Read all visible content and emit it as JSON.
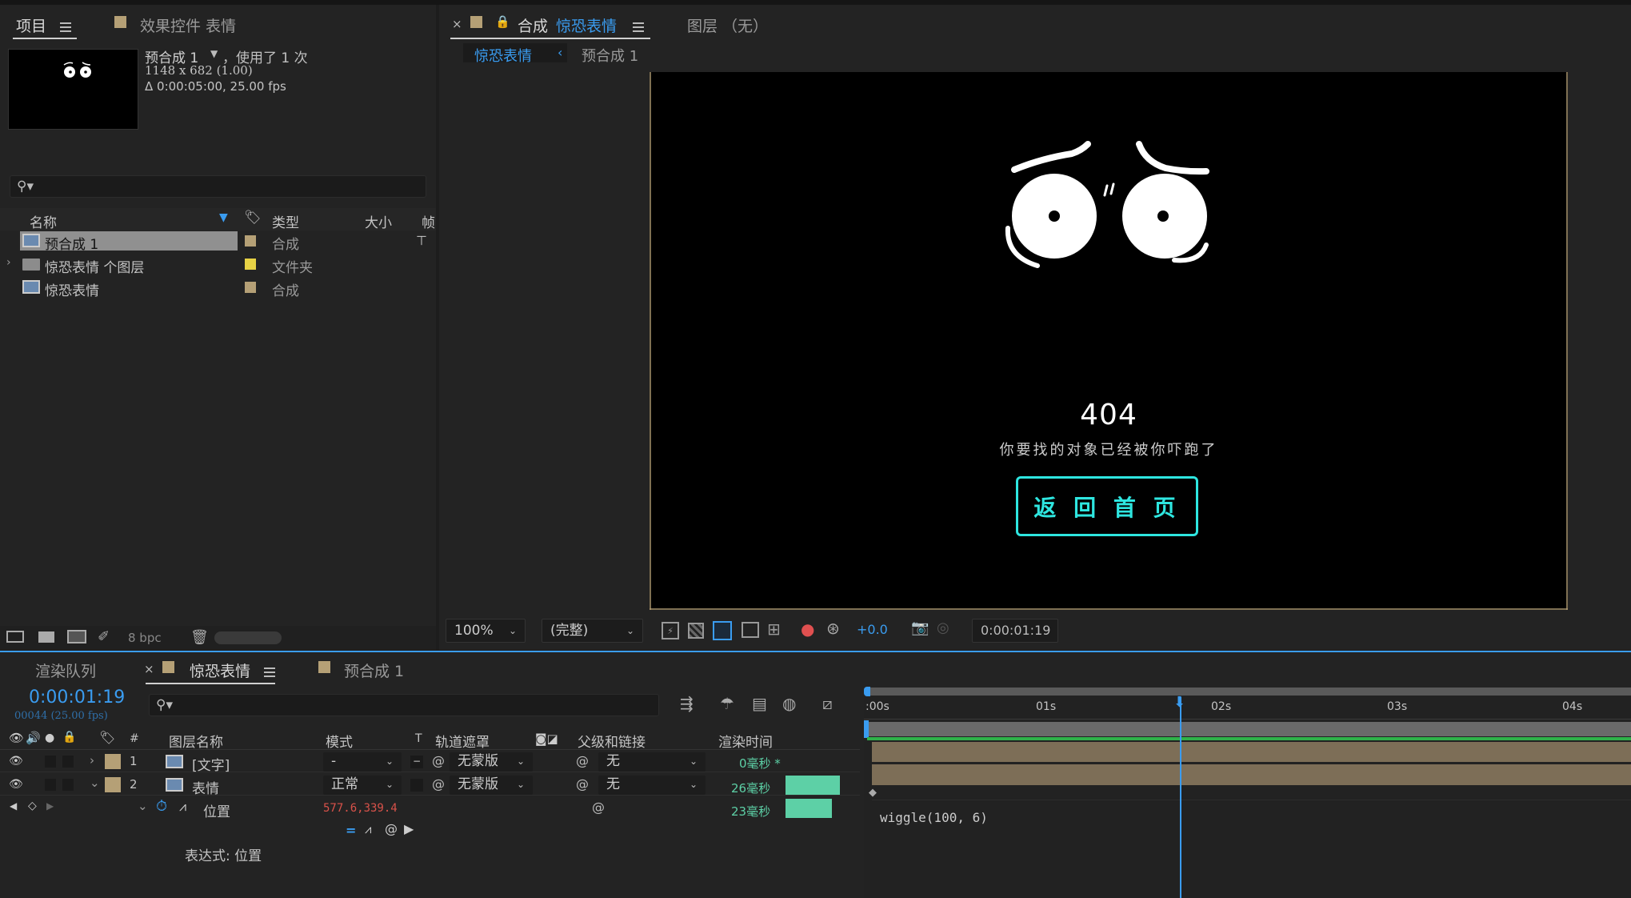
{
  "project_panel": {
    "tab_project": "项目",
    "tab_effects": "效果控件 表情",
    "selected_name": "预合成 1",
    "selected_usage": "，使用了 1 次",
    "selected_dims": "1148 x 682 (1.00)",
    "selected_duration": "Δ 0:00:05:00, 25.00 fps",
    "search_placeholder": "",
    "columns": {
      "name": "名称",
      "type": "类型",
      "size": "大小",
      "frame": "帧"
    },
    "items": [
      {
        "name": "预合成 1",
        "type": "合成",
        "label_color": "#b5a076",
        "selected": true
      },
      {
        "name": "惊恐表情 个图层",
        "type": "文件夹",
        "label_color": "#e7d245",
        "selected": false
      },
      {
        "name": "惊恐表情",
        "type": "合成",
        "label_color": "#b5a076",
        "selected": false
      }
    ],
    "bpc": "8 bpc"
  },
  "viewer": {
    "tab_comp_prefix": "合成",
    "tab_comp_name": "惊恐表情",
    "tab_layer": "图层 （无）",
    "breadcrumb_active": "惊恐表情",
    "breadcrumb_other": "预合成 1",
    "comp_404": "404",
    "comp_subtitle": "你要找的对象已经被你吓跑了",
    "comp_button": "返 回 首 页",
    "zoom": "100%",
    "resolution": "(完整)",
    "exposure": "+0.0",
    "timecode": "0:00:01:19"
  },
  "timeline": {
    "tab_render": "渲染队列",
    "tab_comp": "惊恐表情",
    "tab_precomp": "预合成 1",
    "current_time": "0:00:01:19",
    "frame_info": "00044 (25.00 fps)",
    "search_placeholder": "",
    "headers": {
      "hash": "#",
      "layer_name": "图层名称",
      "mode": "模式",
      "t": "T",
      "track_matte": "轨道遮罩",
      "parent": "父级和链接",
      "render_time": "渲染时间"
    },
    "layers": [
      {
        "num": "1",
        "name": "[文字]",
        "mode": "-",
        "matte": "无蒙版",
        "parent": "无",
        "render_time": "0毫秒 *"
      },
      {
        "num": "2",
        "name": "表情",
        "mode": "正常",
        "matte": "无蒙版",
        "parent": "无",
        "render_time": "26毫秒"
      }
    ],
    "property": {
      "name": "位置",
      "value": "577.6,339.4",
      "render_time": "23毫秒"
    },
    "expression_label": "表达式: 位置",
    "expression_code": "wiggle(100, 6)",
    "ruler": [
      "0s",
      "01s",
      "02s",
      "03s",
      "04s"
    ],
    "ruler_start": ":00s"
  },
  "colors": {
    "accent_blue": "#3a9cf0",
    "comp_cyan": "#2ee6e0",
    "label_tan": "#b5a076",
    "label_yellow": "#e7d245",
    "render_bar": "#5dd0a6",
    "value_red": "#d9524a"
  }
}
